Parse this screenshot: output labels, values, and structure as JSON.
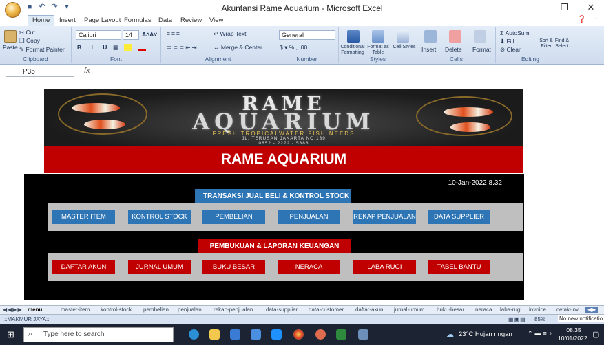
{
  "window": {
    "title": "Akuntansi Rame Aquarium - Microsoft Excel"
  },
  "ribbon_tabs": [
    "Home",
    "Insert",
    "Page Layout",
    "Formulas",
    "Data",
    "Review",
    "View"
  ],
  "clipboard": {
    "cut": "Cut",
    "copy": "Copy",
    "paste": "Paste",
    "format_painter": "Format Painter",
    "label": "Clipboard"
  },
  "font": {
    "name": "Calibri",
    "size": "14",
    "label": "Font"
  },
  "alignment": {
    "wrap": "Wrap Text",
    "merge": "Merge & Center",
    "label": "Alignment"
  },
  "number": {
    "format": "General",
    "label": "Number"
  },
  "styles": {
    "conditional": "Conditional Formatting",
    "format_table": "Format as Table",
    "cell": "Cell Styles",
    "label": "Styles"
  },
  "cells": {
    "insert": "Insert",
    "delete": "Delete",
    "format": "Format",
    "label": "Cells"
  },
  "editing": {
    "autosum": "AutoSum",
    "fill": "Fill",
    "clear": "Clear",
    "sort": "Sort & Filter",
    "find": "Find & Select",
    "label": "Editing"
  },
  "formula_bar": {
    "cell_ref": "P35",
    "fx": "fx"
  },
  "banner": {
    "line1": "RAME",
    "line2": "AQUARIUM",
    "tagline": "FRESH TROPICALWATER FISH NEEDS",
    "address": "JL. TERUSAN JAKARTA NO.139",
    "phone": "0852 - 2222 - 5388"
  },
  "header_title": "RAME AQUARIUM",
  "datetime": "10-Jan-2022 8.32",
  "section1": {
    "title": "TRANSAKSI JUAL BELI & KONTROL STOCK",
    "buttons": [
      "MASTER ITEM",
      "KONTROL STOCK",
      "PEMBELIAN",
      "PENJUALAN",
      "REKAP PENJUALAN",
      "DATA SUPPLIER"
    ]
  },
  "section2": {
    "title": "PEMBUKUAN & LAPORAN KEUANGAN",
    "buttons": [
      "DAFTAR AKUN",
      "JURNAL UMUM",
      "BUKU BESAR",
      "NERACA",
      "LABA RUGI",
      "TABEL BANTU"
    ]
  },
  "sheet_tabs": [
    "menu",
    "master-item",
    "kontrol-stock",
    "pembelian",
    "penjualan",
    "rekap-penjualan",
    "data-supplier",
    "data-customer",
    "daftar-akun",
    "jurnal-umum",
    "buku-besar",
    "neraca",
    "laba-rugi",
    "invoice",
    "cetak-inv"
  ],
  "status": {
    "left": "::MAKMUR JAYA::",
    "zoom": "85%",
    "notification": "No new notificatio"
  },
  "taskbar": {
    "search": "Type here to search",
    "weather": "23°C  Hujan ringan",
    "time": "08.35",
    "date": "10/01/2022"
  },
  "colors": {
    "accent_blue": "#2e75b6",
    "accent_red": "#c00000"
  }
}
